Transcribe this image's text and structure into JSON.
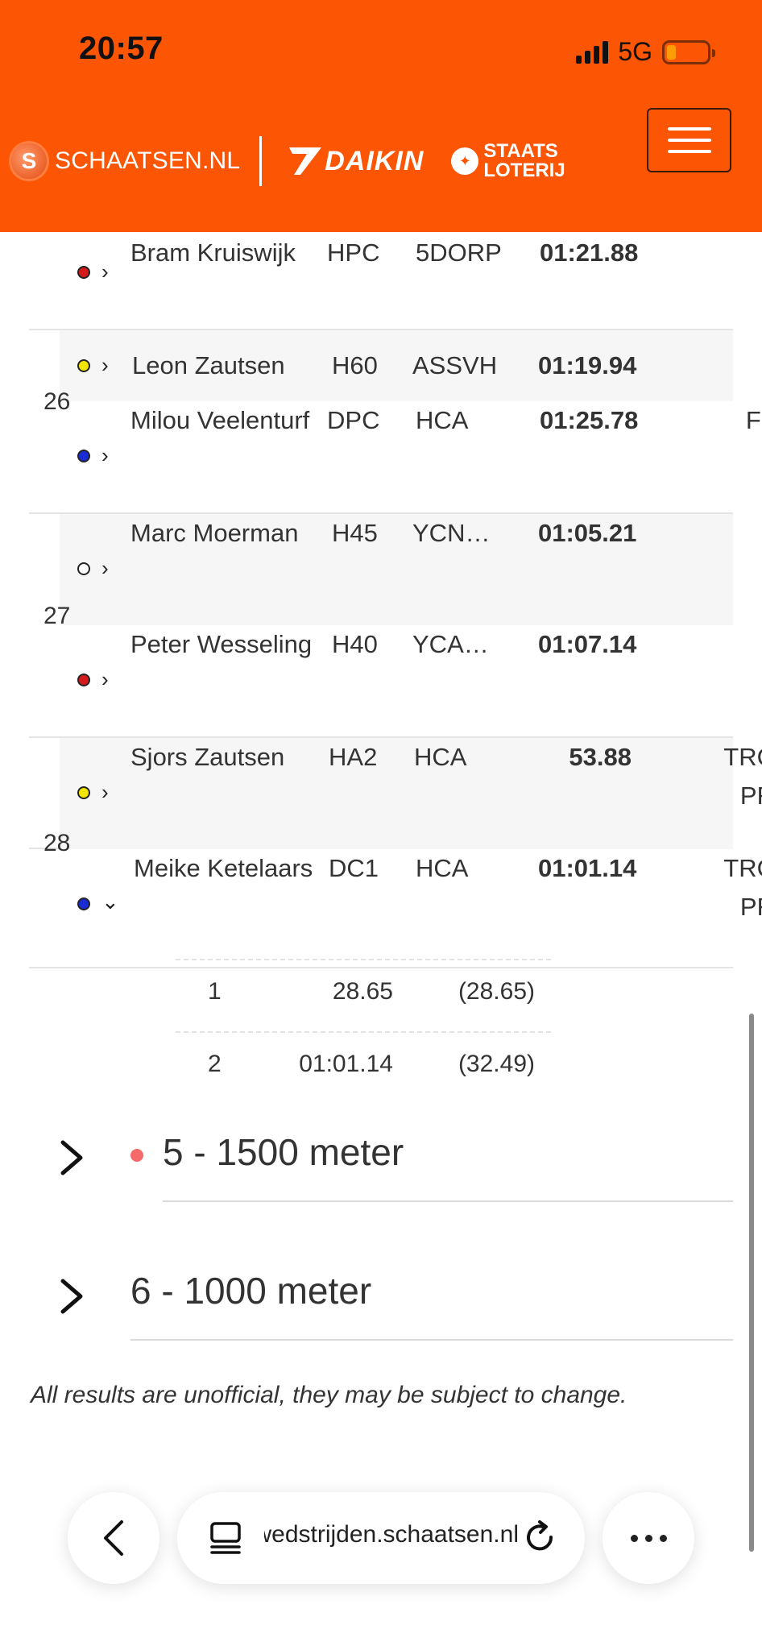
{
  "status_bar": {
    "time": "20:57",
    "network": "5G"
  },
  "header": {
    "schaatsen_logo_letter": "S",
    "schaatsen_label": "SCHAATSEN.NL",
    "daikin_label": "DAIKIN",
    "staats_label_1": "STAATS",
    "staats_label_2": "LOTERIJ"
  },
  "results": {
    "rows": [
      {
        "name": "Bram Kruiswijk",
        "category": "HPC",
        "club": "5DORP",
        "time": "01:21.88",
        "note": "",
        "lane_color": "#d41a1a",
        "expanded": false
      },
      {
        "name": "Leon Zautsen",
        "category": "H60",
        "club": "ASSVH",
        "time": "01:19.94",
        "note": "",
        "lane_color": "#f2e600",
        "expanded": false
      },
      {
        "name": "Milou Veelenturf",
        "category": "DPC",
        "club": "HCA",
        "time": "01:25.78",
        "note": "FL",
        "lane_color": "#1a2ad4",
        "expanded": false
      },
      {
        "name": "Marc Moerman",
        "category": "H45",
        "club": "YCN…",
        "time": "01:05.21",
        "note": "",
        "lane_color": "#ffffff",
        "expanded": false
      },
      {
        "name": "Peter Wesseling",
        "category": "H40",
        "club": "YCA…",
        "time": "01:07.14",
        "note": "",
        "lane_color": "#d41a1a",
        "expanded": false
      },
      {
        "name": "Sjors Zautsen",
        "category": "HA2",
        "club": "HCA",
        "time": "53.88",
        "note": "TRC PR",
        "lane_color": "#f2e600",
        "expanded": false
      },
      {
        "name": "Meike Ketelaars",
        "category": "DC1",
        "club": "HCA",
        "time": "01:01.14",
        "note": "TRC PR",
        "lane_color": "#1a2ad4",
        "expanded": true
      }
    ],
    "pairs": [
      "26",
      "27",
      "28"
    ],
    "splits": [
      {
        "lap": "1",
        "time": "28.65",
        "diff": "(28.65)"
      },
      {
        "lap": "2",
        "time": "01:01.14",
        "diff": "(32.49)"
      }
    ]
  },
  "sections": [
    {
      "title": "5 - 1500 meter",
      "live": true
    },
    {
      "title": "6 - 1000 meter",
      "live": false
    }
  ],
  "disclaimer": "All results are unofficial, they may be subject to change.",
  "browser": {
    "url": "wedstrijden.schaatsen.nl"
  },
  "colors": {
    "brand_orange": "#FC5503",
    "live_dot": "#f76a6a"
  }
}
